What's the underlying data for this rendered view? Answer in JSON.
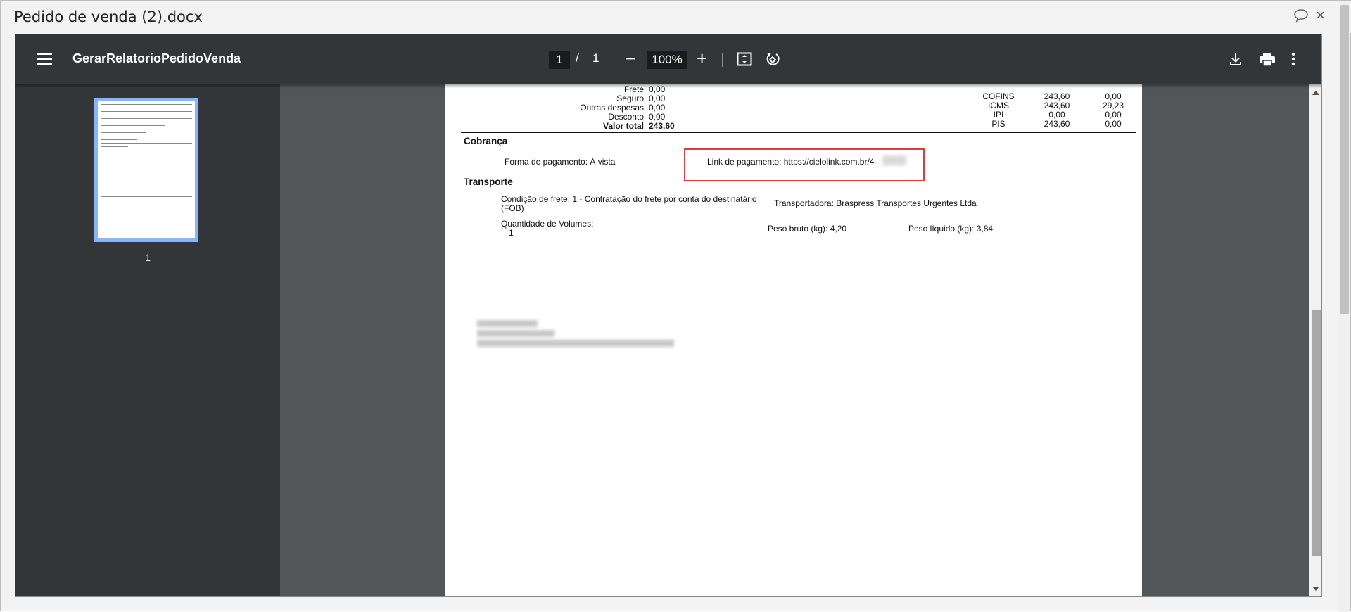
{
  "window": {
    "title": "Pedido de venda (2).docx",
    "close_label": "×"
  },
  "toolbar": {
    "doc_name": "GerarRelatorioPedidoVenda",
    "page_current": "1",
    "page_sep": "/",
    "page_total": "1",
    "zoom_minus": "−",
    "zoom": "100%",
    "zoom_plus": "+"
  },
  "sidebar": {
    "thumb_number": "1"
  },
  "document": {
    "totals_left": [
      {
        "label": "Frete",
        "value": "0,00"
      },
      {
        "label": "Seguro",
        "value": "0,00"
      },
      {
        "label": "Outras despesas",
        "value": "0,00"
      },
      {
        "label": "Desconto",
        "value": "0,00"
      },
      {
        "label": "Valor total",
        "value": "243,60"
      }
    ],
    "taxes": [
      {
        "name": "COFINS",
        "base": "243,60",
        "value": "0,00"
      },
      {
        "name": "ICMS",
        "base": "243,60",
        "value": "29,23"
      },
      {
        "name": "IPI",
        "base": "0,00",
        "value": "0,00"
      },
      {
        "name": "PIS",
        "base": "243,60",
        "value": "0,00"
      }
    ],
    "cobranca": {
      "heading": "Cobrança",
      "forma_pagamento": "Forma de pagamento: À vista",
      "link_pagamento": "Link de pagamento: https://cielolink.com.br/4"
    },
    "transporte": {
      "heading": "Transporte",
      "condicao_frete_1": "Condição de frete: 1 - Contratação do frete por conta do destinatário",
      "condicao_frete_2": "(FOB)",
      "transportadora": "Transportadora: Braspress Transportes Urgentes Ltda",
      "quantidade_label": "Quantidade de Volumes:",
      "quantidade_value": "1",
      "peso_bruto": "Peso bruto (kg): 4,20",
      "peso_liquido": "Peso líquido (kg): 3,84"
    }
  }
}
